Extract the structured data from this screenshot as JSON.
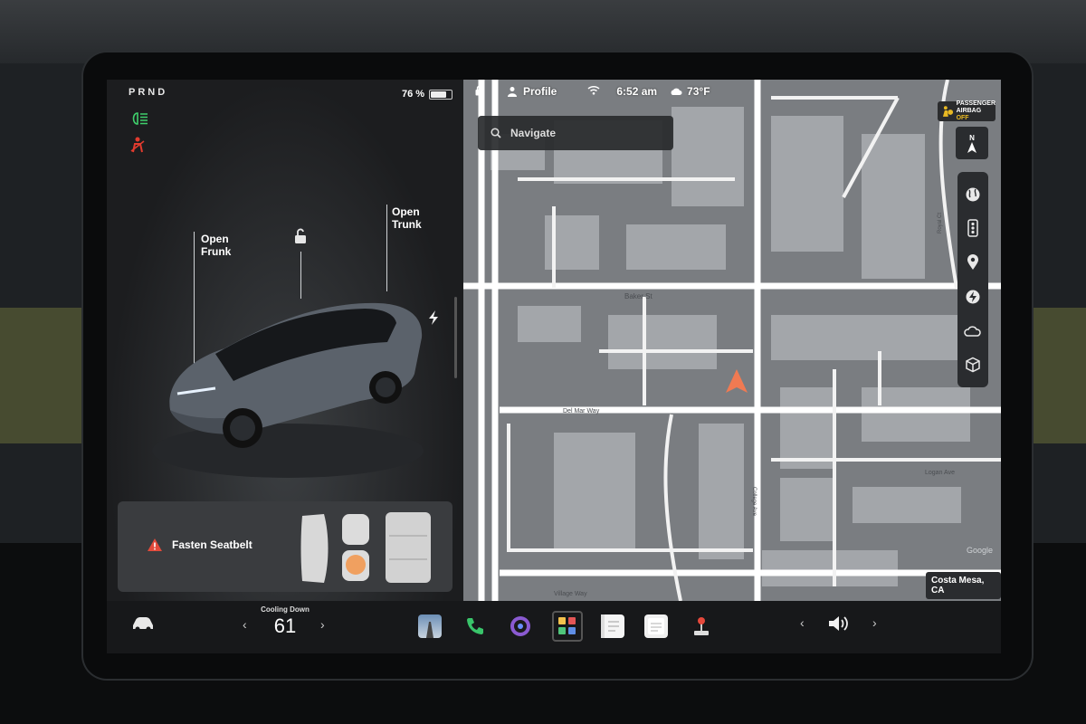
{
  "gear": {
    "label": "PRND"
  },
  "battery": {
    "label": "76 %",
    "percent": 76
  },
  "car_controls": {
    "frunk_label_line1": "Open",
    "frunk_label_line2": "Frunk",
    "trunk_label_line1": "Open",
    "trunk_label_line2": "Trunk"
  },
  "seatbelt": {
    "message": "Fasten Seatbelt"
  },
  "status": {
    "profile_label": "Profile",
    "time": "6:52 am",
    "temperature": "73°F"
  },
  "airbag": {
    "line1": "PASSENGER",
    "line2": "AIRBAG",
    "state": "OFF"
  },
  "compass": {
    "heading": "N"
  },
  "navigate": {
    "placeholder": "Navigate"
  },
  "map": {
    "streets": {
      "baker": "Baker St",
      "del": "Del Mar Way",
      "logan": "Logan Ave",
      "village": "Village Way",
      "college": "College Ave",
      "royal": "Royal Ct"
    },
    "location": "Costa Mesa, CA",
    "attribution": "Google"
  },
  "bottom_bar": {
    "climate_status": "Cooling Down",
    "cabin_temp": "61"
  },
  "colors": {
    "alert_red": "#e23b2e",
    "light_green": "#3fcf6b",
    "nav_arrow": "#f07a52",
    "airbag_yellow": "#e8b923"
  }
}
